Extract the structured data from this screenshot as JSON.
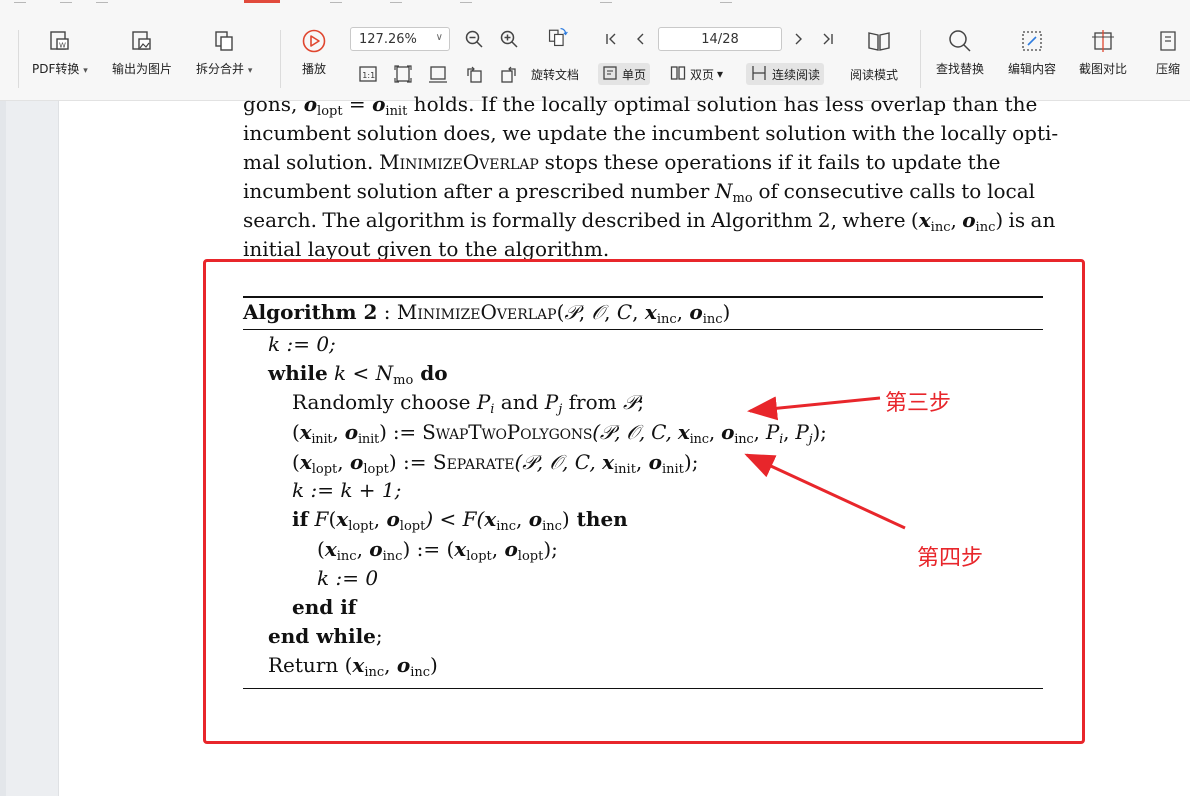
{
  "toolbar": {
    "pdf_convert": "PDF转换",
    "export_image": "输出为图片",
    "split_merge": "拆分合并",
    "play": "播放",
    "zoom": "127.26%",
    "page_indicator": "14/28",
    "rotate_doc": "旋转文档",
    "single_page": "单页",
    "double_page": "双页",
    "continuous_read": "连续阅读",
    "read_mode": "阅读模式",
    "find_replace": "查找替换",
    "edit_content": "编辑内容",
    "screenshot_compare": "截图对比",
    "compress": "压缩",
    "fit_icon_label": "1:1"
  },
  "document": {
    "line1": {
      "a": "gons, ",
      "o1": "o",
      "s1": "lopt",
      "eq": " = ",
      "o2": "o",
      "s2": "init",
      "rest": " holds. If the locally optimal solution has less overlap than the"
    },
    "line2": "incumbent solution does, we update the incumbent solution with the locally opti-",
    "line3": {
      "a": "mal solution. ",
      "sc": "MinimizeOverlap",
      "rest": " stops these operations if it fails to update the"
    },
    "line4": {
      "a": "incumbent solution after a prescribed number ",
      "n": "N",
      "sub": "mo",
      "rest": " of consecutive calls to local"
    },
    "line5": {
      "a": "search. The algorithm is formally described in Algorithm 2, where (",
      "x": "x",
      "xs": "inc",
      "comma": ", ",
      "o": "o",
      "os": "inc",
      "rest": ") is an"
    },
    "line6": "initial layout given to the algorithm."
  },
  "algorithm": {
    "title_bold": "Algorithm 2",
    "title_sep": " : ",
    "title_name": "MinimizeOverlap",
    "title_args": {
      "open": "(",
      "p": "𝒫",
      "c1": ", ",
      "o": "𝒪",
      "c2": ", ",
      "cc": "C",
      "c3": ", ",
      "x": "x",
      "xs": "inc",
      "c4": ", ",
      "ov": "o",
      "os": "inc",
      "close": ")"
    },
    "l1": "k := 0;",
    "l2": {
      "kw": "while",
      "cond_k": " k",
      "lt": " < ",
      "n": "N",
      "sub": "mo",
      "do": " do"
    },
    "l3": {
      "a": "Randomly choose ",
      "p1": "P",
      "s1": "i",
      "and": " and ",
      "p2": "P",
      "s2": "j",
      "from": " from ",
      "set": "𝒫",
      "end": ";"
    },
    "l4": {
      "lhs_x": "x",
      "lhs_xs": "init",
      "lhs_o": "o",
      "lhs_os": "init",
      "assign": ") := ",
      "fn": "SwapTwoPolygons",
      "args": "(𝒫, 𝒪, C, ",
      "ax": "x",
      "axs": "inc",
      "c": ", ",
      "ao": "o",
      "aos": "inc",
      "tail": ", ",
      "pi": "P",
      "pis": "i",
      "c2": ", ",
      "pj": "P",
      "pjs": "j",
      "end": ");"
    },
    "l5": {
      "lhs_x": "x",
      "lhs_xs": "lopt",
      "lhs_o": "o",
      "lhs_os": "lopt",
      "assign": ") := ",
      "fn": "Separate",
      "args": "(𝒫, 𝒪, C, ",
      "ax": "x",
      "axs": "init",
      "c": ", ",
      "ao": "o",
      "aos": "init",
      "end": ");"
    },
    "l6": "k := k + 1;",
    "l7": {
      "kw": "if",
      "f": " F",
      "open": "(",
      "x1": "x",
      "x1s": "lopt",
      "c": ", ",
      "o1": "o",
      "o1s": "lopt",
      "lt": ") < F(",
      "x2": "x",
      "x2s": "inc",
      "c2": ", ",
      "o2": "o",
      "o2s": "inc",
      "close": ")",
      "then": " then"
    },
    "l8": {
      "lx": "x",
      "lxs": "inc",
      "c": ", ",
      "lo": "o",
      "los": "inc",
      "assign": ") := (",
      "rx": "x",
      "rxs": "lopt",
      "c2": ", ",
      "ro": "o",
      "ros": "lopt",
      "end": ");"
    },
    "l9": "k := 0",
    "l10": "end if",
    "l11_kw": "end while",
    "l11_end": ";",
    "l12": {
      "a": "Return (",
      "x": "x",
      "xs": "inc",
      "c": ", ",
      "o": "o",
      "os": "inc",
      "end": ")"
    }
  },
  "annotations": {
    "step3": "第三步",
    "step4": "第四步",
    "color": "#e8262b"
  }
}
